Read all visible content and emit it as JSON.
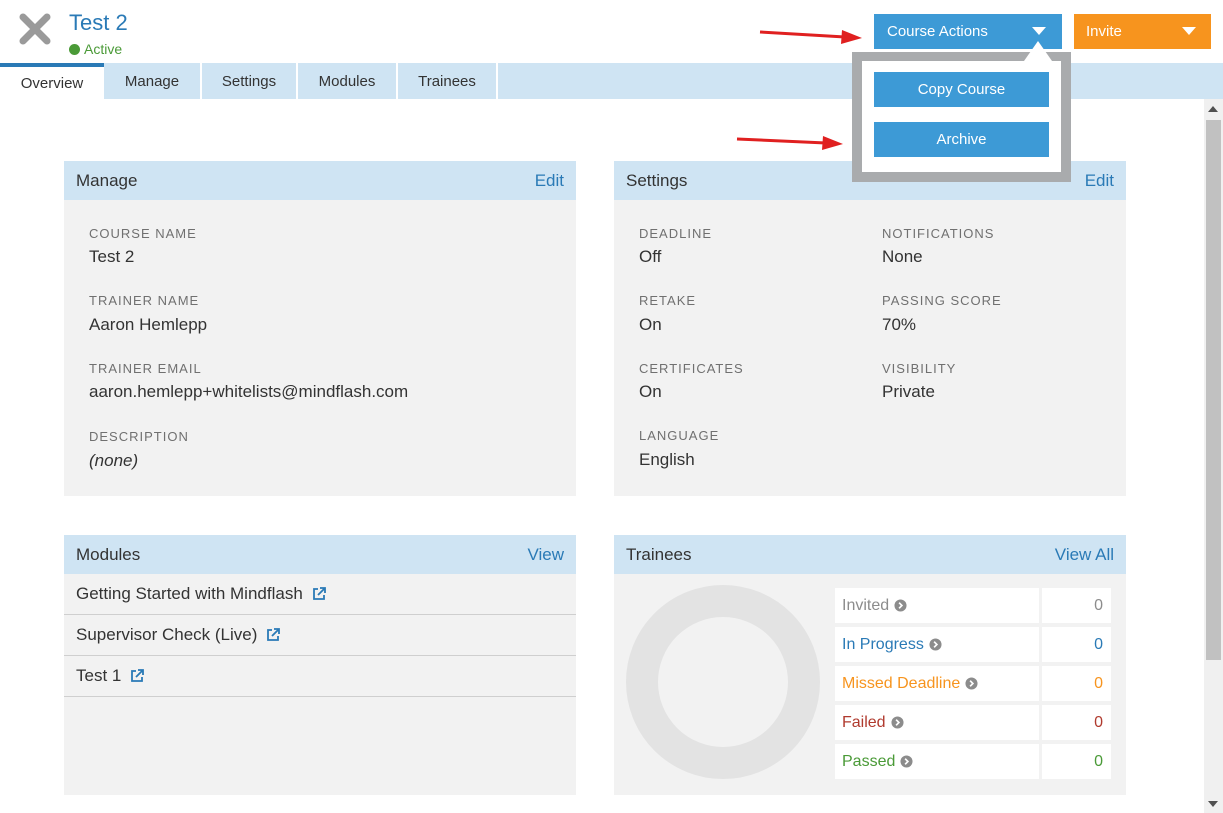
{
  "header": {
    "title": "Test 2",
    "status": "Active",
    "close_icon": "close-x-icon"
  },
  "tabs": [
    {
      "label": "Overview",
      "active": true
    },
    {
      "label": "Manage",
      "active": false
    },
    {
      "label": "Settings",
      "active": false
    },
    {
      "label": "Modules",
      "active": false
    },
    {
      "label": "Trainees",
      "active": false
    }
  ],
  "actions": {
    "course_actions_label": "Course Actions",
    "invite_label": "Invite",
    "dropdown_items": [
      "Copy Course",
      "Archive"
    ]
  },
  "manage": {
    "title": "Manage",
    "edit_label": "Edit",
    "course_name_label": "COURSE NAME",
    "course_name": "Test 2",
    "trainer_name_label": "TRAINER NAME",
    "trainer_name": "Aaron Hemlepp",
    "trainer_email_label": "TRAINER EMAIL",
    "trainer_email": "aaron.hemlepp+whitelists@mindflash.com",
    "description_label": "DESCRIPTION",
    "description": "(none)"
  },
  "settings": {
    "title": "Settings",
    "edit_label": "Edit",
    "deadline_label": "DEADLINE",
    "deadline": "Off",
    "notifications_label": "NOTIFICATIONS",
    "notifications": "None",
    "retake_label": "RETAKE",
    "retake": "On",
    "passing_score_label": "PASSING SCORE",
    "passing_score": "70%",
    "certificates_label": "CERTIFICATES",
    "certificates": "On",
    "visibility_label": "VISIBILITY",
    "visibility": "Private",
    "language_label": "LANGUAGE",
    "language": "English"
  },
  "modules": {
    "title": "Modules",
    "view_label": "View",
    "items": [
      "Getting Started with Mindflash",
      "Supervisor Check (Live)",
      "Test 1"
    ]
  },
  "trainees": {
    "title": "Trainees",
    "view_all_label": "View All",
    "rows": [
      {
        "label": "Invited",
        "count": "0",
        "color": "#8c8c8c"
      },
      {
        "label": "In Progress",
        "count": "0",
        "color": "#2a7ab6"
      },
      {
        "label": "Missed Deadline",
        "count": "0",
        "color": "#f7941e"
      },
      {
        "label": "Failed",
        "count": "0",
        "color": "#b03a2e"
      },
      {
        "label": "Passed",
        "count": "0",
        "color": "#4a9a37"
      }
    ]
  },
  "colors": {
    "accent": "#3d9ad6",
    "invite": "#f7941e",
    "active": "#4a9a37",
    "arrow": "#e02020"
  }
}
